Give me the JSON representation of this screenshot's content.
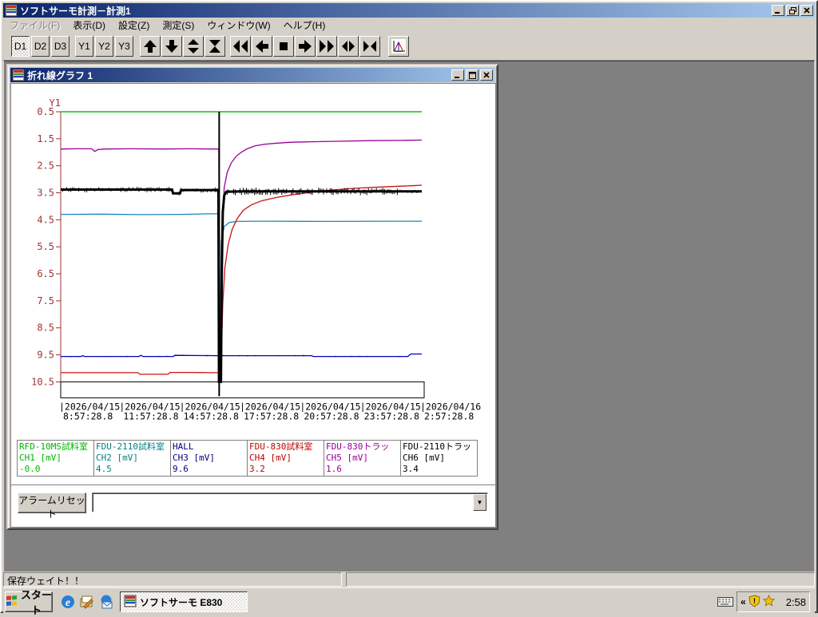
{
  "window": {
    "title": "ソフトサーモ計測－計測1"
  },
  "menu": {
    "items": [
      {
        "label": "ファイル(F)",
        "disabled": true
      },
      {
        "label": "表示(D)"
      },
      {
        "label": "設定(Z)"
      },
      {
        "label": "測定(S)"
      },
      {
        "label": "ウィンドウ(W)"
      },
      {
        "label": "ヘルプ(H)"
      }
    ]
  },
  "toolbar": {
    "display_buttons": [
      "D1",
      "D2",
      "D3"
    ],
    "y_buttons": [
      "Y1",
      "Y2",
      "Y3"
    ],
    "nav_icons": [
      "up-arrow",
      "down-arrow",
      "expand-vertical",
      "compress-vertical",
      "rewind",
      "left-arrow",
      "stop",
      "right-arrow",
      "fast-forward",
      "expand-horizontal",
      "compress-horizontal"
    ],
    "chart_button_icon": "chart-icon"
  },
  "graph_window": {
    "title": "折れ線グラフ 1"
  },
  "chart_data": {
    "type": "line",
    "title": "折れ線グラフ 1",
    "y_axis": {
      "label": "Y1",
      "min": 0.5,
      "max": 10.5,
      "inverted": true,
      "ticks": [
        0.5,
        1.5,
        2.5,
        3.5,
        4.5,
        5.5,
        6.5,
        7.5,
        8.5,
        9.5,
        10.5
      ],
      "color": "#9c3434"
    },
    "x_axis": {
      "hours_span": 18,
      "ticks": [
        {
          "date": "2026/04/15",
          "time": "8:57:28.8"
        },
        {
          "date": "2026/04/15",
          "time": "11:57:28.8"
        },
        {
          "date": "2026/04/15",
          "time": "14:57:28.8"
        },
        {
          "date": "2026/04/15",
          "time": "17:57:28.8"
        },
        {
          "date": "2026/04/15",
          "time": "20:57:28.8"
        },
        {
          "date": "2026/04/15",
          "time": "23:57:28.8"
        },
        {
          "date": "2026/04/16",
          "time": "2:57:28.8"
        }
      ]
    },
    "event_line": {
      "hour": 7.9
    },
    "series": [
      {
        "name": "CH1",
        "color": "#00cc00",
        "width": 1.5,
        "points": [
          [
            0,
            0.5
          ],
          [
            18,
            0.5
          ]
        ]
      },
      {
        "name": "CH2",
        "color": "#1e86b4",
        "width": 1.3,
        "points": [
          [
            0,
            4.3
          ],
          [
            2,
            4.29
          ],
          [
            4,
            4.31
          ],
          [
            6,
            4.3
          ],
          [
            7.3,
            4.28
          ],
          [
            7.85,
            4.28
          ],
          [
            7.93,
            10.35
          ],
          [
            8.0,
            5.3
          ],
          [
            8.15,
            4.75
          ],
          [
            8.4,
            4.6
          ],
          [
            8.8,
            4.56
          ],
          [
            10,
            4.55
          ],
          [
            13,
            4.56
          ],
          [
            18,
            4.55
          ]
        ],
        "noise": [
          {
            "from": 0.3,
            "to": 7.7,
            "amp": 0.02,
            "step": 0.5
          }
        ]
      },
      {
        "name": "CH3",
        "color": "#0000bb",
        "width": 1.3,
        "points": [
          [
            0,
            9.56
          ],
          [
            1,
            9.56
          ],
          [
            1.1,
            9.53
          ],
          [
            1.2,
            9.56
          ],
          [
            3.9,
            9.56
          ],
          [
            4.0,
            9.52
          ],
          [
            4.1,
            9.56
          ],
          [
            5.6,
            9.56
          ],
          [
            5.7,
            9.52
          ],
          [
            7.87,
            9.53
          ],
          [
            7.91,
            10.15
          ],
          [
            7.96,
            9.53
          ],
          [
            12.5,
            9.53
          ],
          [
            12.6,
            9.56
          ],
          [
            17.3,
            9.56
          ],
          [
            17.45,
            9.47
          ],
          [
            18,
            9.47
          ]
        ],
        "noise": [
          {
            "from": 0.5,
            "to": 17,
            "amp": 0.03,
            "step": 0.4
          }
        ]
      },
      {
        "name": "CH4",
        "color": "#cc1111",
        "width": 1.3,
        "points": [
          [
            0,
            10.16
          ],
          [
            3.85,
            10.16
          ],
          [
            3.95,
            10.22
          ],
          [
            5.35,
            10.22
          ],
          [
            5.45,
            10.15
          ],
          [
            6.5,
            10.15
          ],
          [
            7.5,
            10.16
          ],
          [
            7.87,
            10.16
          ],
          [
            7.92,
            10.45
          ],
          [
            7.97,
            10.3
          ],
          [
            8.02,
            9.2
          ],
          [
            8.08,
            7.6
          ],
          [
            8.18,
            6.3
          ],
          [
            8.35,
            5.4
          ],
          [
            8.55,
            4.85
          ],
          [
            8.8,
            4.45
          ],
          [
            9.1,
            4.15
          ],
          [
            9.5,
            3.95
          ],
          [
            10,
            3.8
          ],
          [
            10.7,
            3.68
          ],
          [
            11.5,
            3.58
          ],
          [
            12.5,
            3.48
          ],
          [
            13.5,
            3.4
          ],
          [
            14.5,
            3.34
          ],
          [
            15.5,
            3.3
          ],
          [
            16.5,
            3.27
          ],
          [
            17.5,
            3.24
          ],
          [
            18,
            3.22
          ]
        ]
      },
      {
        "name": "CH5",
        "color": "#990099",
        "width": 1.3,
        "points": [
          [
            0,
            1.88
          ],
          [
            0.8,
            1.87
          ],
          [
            1.55,
            1.87
          ],
          [
            1.7,
            1.97
          ],
          [
            1.85,
            1.9
          ],
          [
            2.2,
            1.88
          ],
          [
            3.5,
            1.87
          ],
          [
            5,
            1.88
          ],
          [
            6.5,
            1.87
          ],
          [
            7.6,
            1.88
          ],
          [
            7.88,
            1.88
          ],
          [
            7.93,
            10.4
          ],
          [
            7.99,
            8.0
          ],
          [
            8.05,
            4.6
          ],
          [
            8.15,
            3.3
          ],
          [
            8.3,
            2.75
          ],
          [
            8.5,
            2.4
          ],
          [
            8.75,
            2.15
          ],
          [
            9.0,
            2.0
          ],
          [
            9.3,
            1.87
          ],
          [
            9.7,
            1.76
          ],
          [
            10.2,
            1.7
          ],
          [
            10.8,
            1.66
          ],
          [
            11.5,
            1.63
          ],
          [
            12.5,
            1.61
          ],
          [
            14,
            1.59
          ],
          [
            15.5,
            1.57
          ],
          [
            17,
            1.56
          ],
          [
            18,
            1.55
          ]
        ]
      },
      {
        "name": "CH6",
        "color": "#000000",
        "width": 3,
        "points": [
          [
            0,
            3.38
          ],
          [
            5.55,
            3.38
          ],
          [
            5.6,
            3.52
          ],
          [
            5.95,
            3.52
          ],
          [
            6.0,
            3.4
          ],
          [
            7.86,
            3.4
          ],
          [
            7.89,
            10.5
          ],
          [
            7.99,
            10.5
          ],
          [
            8.03,
            6.5
          ],
          [
            8.08,
            4.2
          ],
          [
            8.15,
            3.6
          ],
          [
            8.25,
            3.46
          ],
          [
            9,
            3.45
          ],
          [
            18,
            3.45
          ]
        ],
        "noise": [
          {
            "from": 0.1,
            "to": 7.8,
            "amp": 0.1,
            "step": 0.1
          },
          {
            "from": 8.3,
            "to": 16.8,
            "amp": 0.14,
            "step": 0.08
          },
          {
            "from": 16.8,
            "to": 17.9,
            "amp": 0.07,
            "step": 0.12
          }
        ]
      }
    ]
  },
  "legend": {
    "channels": [
      {
        "device": "RFD-10MS試料室",
        "channel": "CH1 [mV]",
        "value": "-0.0",
        "color": "#00b400"
      },
      {
        "device": "FDU-2110試料室",
        "channel": "CH2 [mV]",
        "value": "4.5",
        "color": "#008080"
      },
      {
        "device": "HALL",
        "channel": "CH3 [mV]",
        "value": "9.6",
        "color": "#000080"
      },
      {
        "device": "FDU-830試料室",
        "channel": "CH4 [mV]",
        "value": "3.2",
        "color": "#c00000"
      },
      {
        "device": "FDU-830トラッ",
        "channel": "CH5 [mV]",
        "value": "1.6",
        "color": "#990099"
      },
      {
        "device": "FDU-2110トラッ",
        "channel": "CH6 [mV]",
        "value": "3.4",
        "color": "#000000"
      }
    ]
  },
  "alarm": {
    "reset_label": "アラームリセット",
    "combo_value": ""
  },
  "status_bar": {
    "text": "保存ウェイト！！"
  },
  "taskbar": {
    "start_label": "スタート",
    "task_label": "ソフトサーモ E830",
    "tray_chevron": "«",
    "clock": "2:58"
  }
}
